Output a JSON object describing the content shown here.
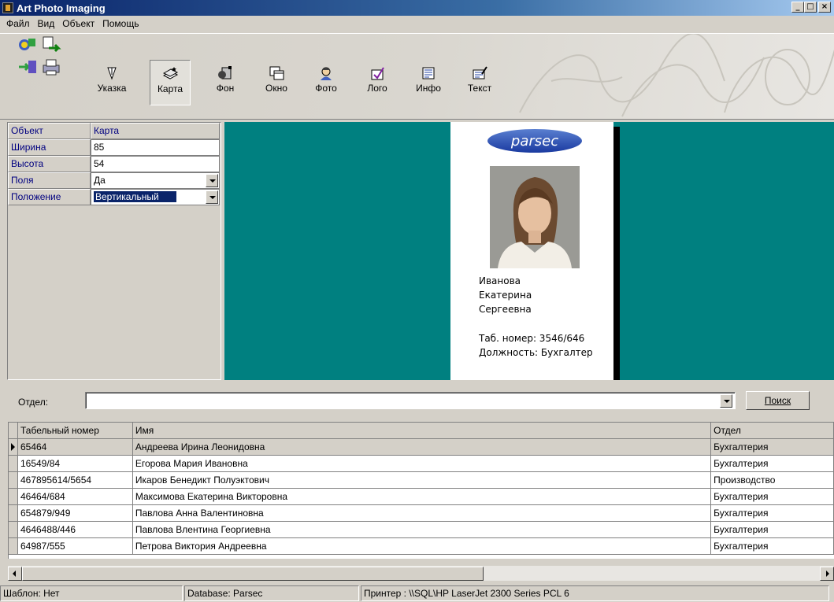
{
  "window": {
    "title": "Art Photo Imaging",
    "buttons": [
      "_",
      "□",
      "×"
    ]
  },
  "menu": [
    "Файл",
    "Вид",
    "Объект",
    "Помощь"
  ],
  "toolbar": {
    "quick_icons": [
      "wizard-icon",
      "export-icon",
      "import-icon",
      "print-icon"
    ],
    "buttons": [
      {
        "label": "Указка",
        "icon": "pointer-icon",
        "pressed": false
      },
      {
        "label": "Карта",
        "icon": "card-icon",
        "pressed": true
      },
      {
        "label": "Фон",
        "icon": "background-icon",
        "pressed": false
      },
      {
        "label": "Окно",
        "icon": "window-icon",
        "pressed": false
      },
      {
        "label": "Фото",
        "icon": "photo-icon",
        "pressed": false
      },
      {
        "label": "Лого",
        "icon": "logo-icon",
        "pressed": false
      },
      {
        "label": "Инфо",
        "icon": "info-icon",
        "pressed": false
      },
      {
        "label": "Текст",
        "icon": "text-icon",
        "pressed": false
      }
    ]
  },
  "properties": [
    {
      "key": "Объект",
      "value": "Карта"
    },
    {
      "key": "Ширина",
      "value": "85"
    },
    {
      "key": "Высота",
      "value": "54"
    },
    {
      "key": "Поля",
      "value": "Да"
    },
    {
      "key": "Положение",
      "value": "Вертикальный"
    }
  ],
  "card": {
    "logo": "parsec",
    "name_lines": [
      "Иванова",
      "Екатерина",
      "Сергеевна"
    ],
    "tab_number": "Таб. номер: 3546/646",
    "position": "Должность: Бухгалтер"
  },
  "filter": {
    "label": "Отдел:",
    "value": "",
    "search_button": "Поиск"
  },
  "table": {
    "columns": [
      "Табельный номер",
      "Имя",
      "Отдел"
    ],
    "rows": [
      [
        "65464",
        "Андреева Ирина Леонидовна",
        "Бухгалтерия"
      ],
      [
        "16549/84",
        "Егорова Мария Ивановна",
        "Бухгалтерия"
      ],
      [
        "467895614/5654",
        "Икаров Бенедикт Полуэктович",
        "Производство"
      ],
      [
        "46464/684",
        "Максимова Екатерина Викторовна",
        "Бухгалтерия"
      ],
      [
        "654879/949",
        "Павлова Анна Валентиновна",
        "Бухгалтерия"
      ],
      [
        "4646488/446",
        "Павлова Влентина Георгиевна",
        "Бухгалтерия"
      ],
      [
        "64987/555",
        "Петрова Виктория Андреевна",
        "Бухгалтерия"
      ]
    ]
  },
  "status": {
    "template": "Шаблон: Нет",
    "database": "Database: Parsec",
    "printer": "Принтер : \\\\SQL\\HP LaserJet 2300 Series PCL 6"
  },
  "colors": {
    "canvas": "#008080",
    "title_bar": "#0a246a",
    "label_text": "#000080",
    "selection": "#0a246a"
  }
}
